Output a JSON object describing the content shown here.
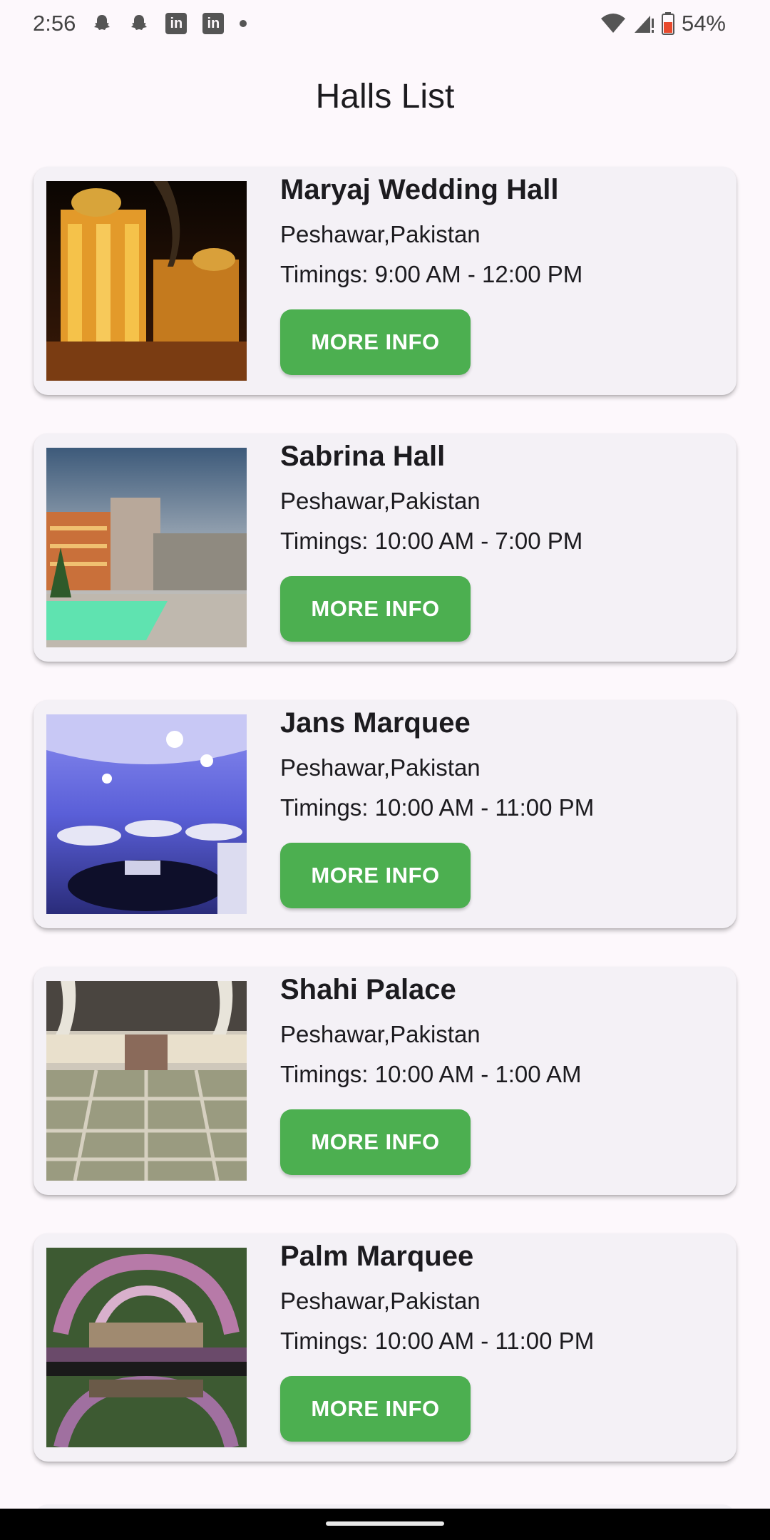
{
  "status_bar": {
    "time": "2:56",
    "battery": "54%",
    "notification_icons": [
      "snapchat-icon",
      "snapchat-icon",
      "linkedin-icon",
      "linkedin-icon",
      "more-dot-icon"
    ]
  },
  "header": {
    "title": "Halls List"
  },
  "colors": {
    "accent": "#4caf50",
    "card_bg": "#f4f1f6",
    "page_bg": "#fdf8fc"
  },
  "halls": [
    {
      "name": "Maryaj Wedding Hall",
      "location": "Peshawar,Pakistan",
      "timings": "Timings: 9:00 AM - 12:00 PM",
      "button": "MORE INFO"
    },
    {
      "name": "Sabrina Hall",
      "location": "Peshawar,Pakistan",
      "timings": "Timings: 10:00 AM - 7:00 PM",
      "button": "MORE INFO"
    },
    {
      "name": "Jans Marquee",
      "location": "Peshawar,Pakistan",
      "timings": "Timings: 10:00 AM - 11:00 PM",
      "button": "MORE INFO"
    },
    {
      "name": "Shahi Palace",
      "location": "Peshawar,Pakistan",
      "timings": "Timings: 10:00 AM - 1:00 AM",
      "button": "MORE INFO"
    },
    {
      "name": "Palm Marquee",
      "location": "Peshawar,Pakistan",
      "timings": "Timings: 10:00 AM - 11:00 PM",
      "button": "MORE INFO"
    }
  ]
}
